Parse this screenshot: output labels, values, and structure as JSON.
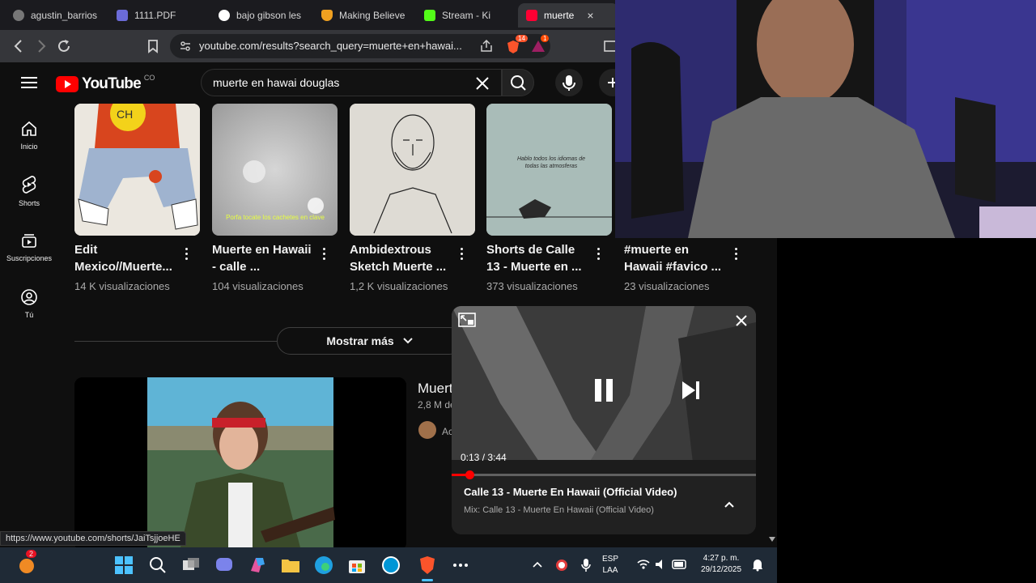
{
  "browser": {
    "tabs": [
      {
        "label": "agustin_barrios",
        "favicon_color": "#777777"
      },
      {
        "label": "1111.PDF",
        "favicon_color": "#6b6bd8"
      },
      {
        "label": "bajo gibson les",
        "favicon_color": "#ffffff"
      },
      {
        "label": "Making Believe",
        "favicon_color": "#f0a020"
      },
      {
        "label": "Stream - Ki",
        "favicon_color": "#53fc18"
      },
      {
        "label": "muerte",
        "favicon_color": "#ff0033",
        "active": true
      }
    ],
    "close_tab_glyph": "×",
    "url": "youtube.com/results?search_query=muerte+en+hawai...",
    "extension_badges": [
      "14",
      "1"
    ]
  },
  "youtube": {
    "logo_text": "YouTube",
    "logo_suffix": "CO",
    "search_query": "muerte en hawai douglas",
    "sidebar": [
      {
        "label": "Inicio",
        "icon": "home-icon"
      },
      {
        "label": "Shorts",
        "icon": "shorts-icon"
      },
      {
        "label": "Suscripciones",
        "icon": "subscriptions-icon"
      },
      {
        "label": "Tú",
        "icon": "you-icon"
      }
    ],
    "shorts": [
      {
        "title": "Edit Mexico//Muerte...",
        "views": "14 K visualizaciones",
        "thumb_text": "CH"
      },
      {
        "title": "Muerte en Hawaii - calle ...",
        "views": "104 visualizaciones",
        "thumb_text": "Porfa tocate los cachetes en clave"
      },
      {
        "title": "Ambidextrous Sketch Muerte ...",
        "views": "1,2 K visualizaciones",
        "thumb_text": ""
      },
      {
        "title": "Shorts de Calle 13 - Muerte en ...",
        "views": "373 visualizaciones",
        "thumb_text": "Hablo todos los idiomas de todas las atmosferas"
      },
      {
        "title": "#muerte en Hawaii #favico ...",
        "views": "23 visualizaciones",
        "thumb_text": ""
      }
    ],
    "show_more_label": "Mostrar más",
    "result": {
      "title": "Muert",
      "meta": "2,8 M de",
      "channel": "Ac"
    },
    "miniplayer": {
      "time": "0:13 / 3:44",
      "progress_fraction": 0.059,
      "title": "Calle 13 - Muerte En Hawaii (Official Video)",
      "subtitle": "Mix: Calle 13 - Muerte En Hawaii (Official Video)"
    },
    "status_url": "https://www.youtube.com/shorts/JaiTsjjoeHE"
  },
  "taskbar": {
    "notification_badge": "2",
    "language": {
      "line1": "ESP",
      "line2": "LAA"
    },
    "time": "4:27 p. m.",
    "date": "29/12/2025"
  },
  "colors": {
    "yt_red": "#ff0000",
    "background": "#0f0f0f",
    "taskbar": "#1f2a36"
  }
}
